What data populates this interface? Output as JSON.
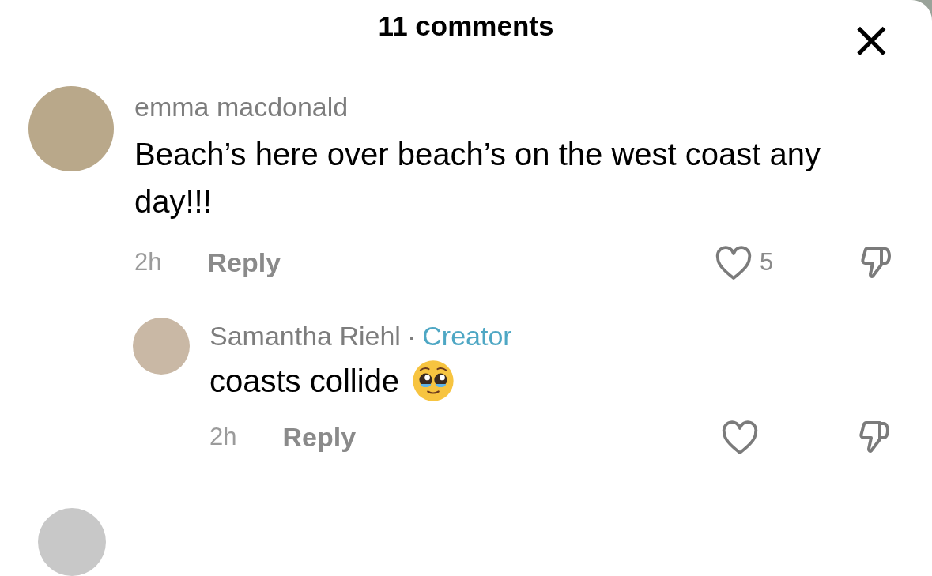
{
  "header": {
    "title": "11 comments",
    "close": "×"
  },
  "comments": [
    {
      "author": "emma macdonald",
      "text": "Beach’s here over beach’s on the west coast any day!!!",
      "time": "2h",
      "reply": "Reply",
      "likes": "5",
      "liked": false,
      "replies": [
        {
          "author": "Samantha Riehl",
          "separator": "·",
          "badge": "Creator",
          "text": "coasts collide",
          "emoji": true,
          "time": "2h",
          "reply": "Reply",
          "liked": false
        }
      ]
    }
  ],
  "more_below": true
}
